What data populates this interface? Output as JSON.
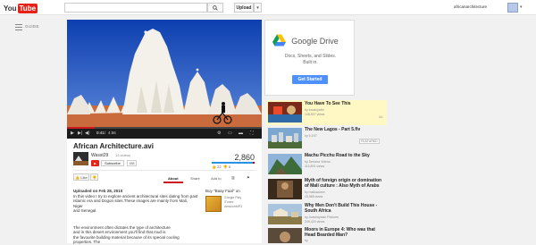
{
  "masthead": {
    "logo_you": "You",
    "logo_tube": "Tube",
    "search_placeholder": "",
    "upload_label": "Upload",
    "username": "africanarchitecture",
    "colors": {
      "brand_red": "#e62117"
    }
  },
  "guide": {
    "label": "GUIDE"
  },
  "player": {
    "time_current": "0:41",
    "time_total": "4:56",
    "progress_fraction": 0.14
  },
  "ad": {
    "brand": "Google Drive",
    "tagline_1": "Docs, Sheets, and Slides.",
    "tagline_2": "Built in.",
    "cta": "Get Started"
  },
  "video": {
    "title": "African Architecture.avi",
    "channel": "Wasst29",
    "channel_videos": "13 videos",
    "subscribe_label": "Subscribe",
    "subscriber_count": "188",
    "view_count": "2,860",
    "likes": "22",
    "dislikes": "0",
    "like_fraction": 0.96,
    "like_label": "Like",
    "tabs": [
      "About",
      "Share",
      "Add to"
    ],
    "upload_date": "Uploaded on Feb 28, 2010",
    "description_1": "In this video I try to explore ancient architectural sites dating from past\nIslamic era and Dogon sites.These images are mainly from Mali, Niger\nand Senegal.",
    "description_2": "The environment often dictates the type of architecture\nand in this desert environment you'll find that mud is\nthe favourite building material because of its special cooling properties. The"
  },
  "buy": {
    "title": "Buy \"Baay Faal\" on",
    "stores": [
      "Google Play",
      "iTunes",
      "AmazonMP3"
    ]
  },
  "sidebar": {
    "ad_label": "Ad",
    "featured_label": "FEATURED",
    "items": [
      {
        "title": "You Have To See This",
        "by": "by lovatoyahh",
        "views": "108,507 views",
        "duration": "",
        "highlight": true
      },
      {
        "title": "The New Lagos - Part 5.flv",
        "by": "by 5.1ST",
        "views": "",
        "duration": "",
        "featured": true
      },
      {
        "title": "Machu Picchu Road to the Sky",
        "by": "by Serrana Videos",
        "views": "114,891 views",
        "duration": ""
      },
      {
        "title": "Myth of foreign origin or domination of Mali culture : Also Myth of Arabs",
        "by": "by malisadunn",
        "views": "15,985 views",
        "duration": ""
      },
      {
        "title": "Why Men Don't Build This House - South Africa",
        "by": "by Joashaysam Pictures",
        "views": "249,420 views",
        "duration": ""
      },
      {
        "title": "Moors in Europe 4: Who was that Head Bearded Man?",
        "by": "by",
        "views": "",
        "duration": ""
      }
    ]
  }
}
